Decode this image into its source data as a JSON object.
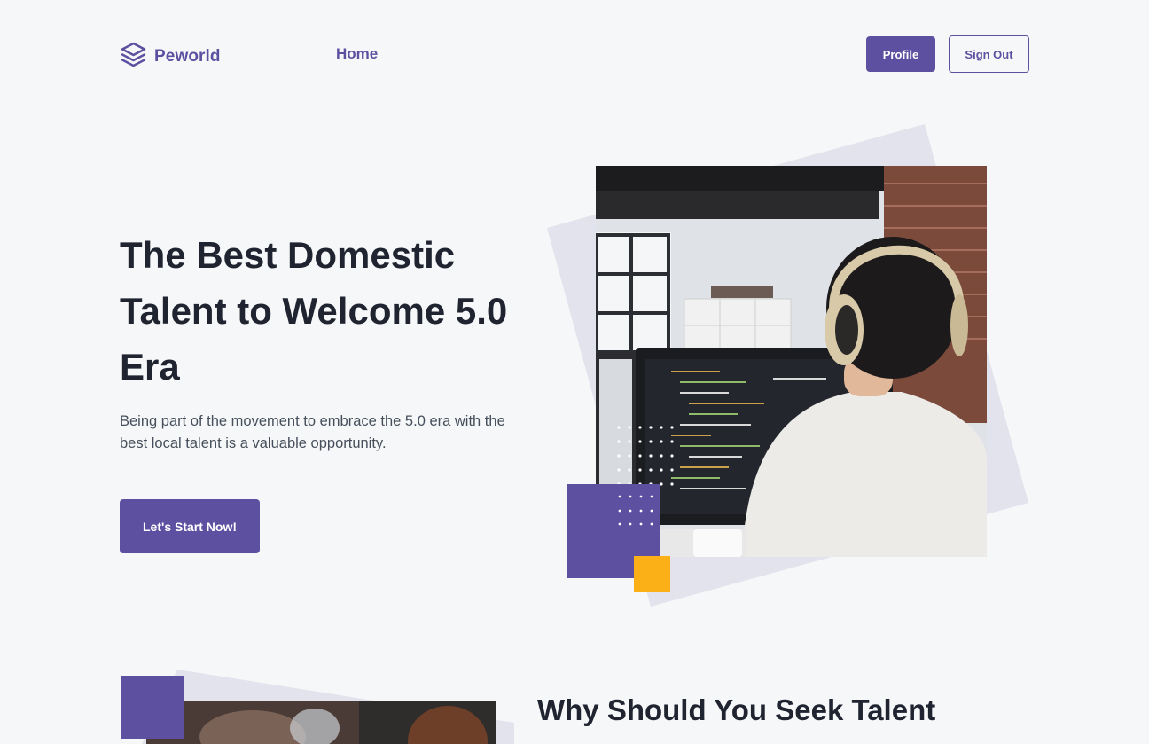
{
  "nav": {
    "logo_text": "Peworld",
    "home_label": "Home",
    "profile_label": "Profile",
    "signout_label": "Sign Out"
  },
  "hero": {
    "title": "The Best Domestic Talent to Welcome 5.0 Era",
    "subtitle": "Being part of the movement to embrace the 5.0 era with the best local talent is a valuable opportunity.",
    "cta_label": "Let's Start Now!"
  },
  "section2": {
    "title": "Why Should You Seek Talent"
  },
  "colors": {
    "brand_purple": "#5e50a1",
    "accent_yellow": "#fbb017",
    "background": "#f6f7f8",
    "tilt_gray": "#e2e3ec"
  },
  "icons": {
    "logo": "layers-icon"
  }
}
